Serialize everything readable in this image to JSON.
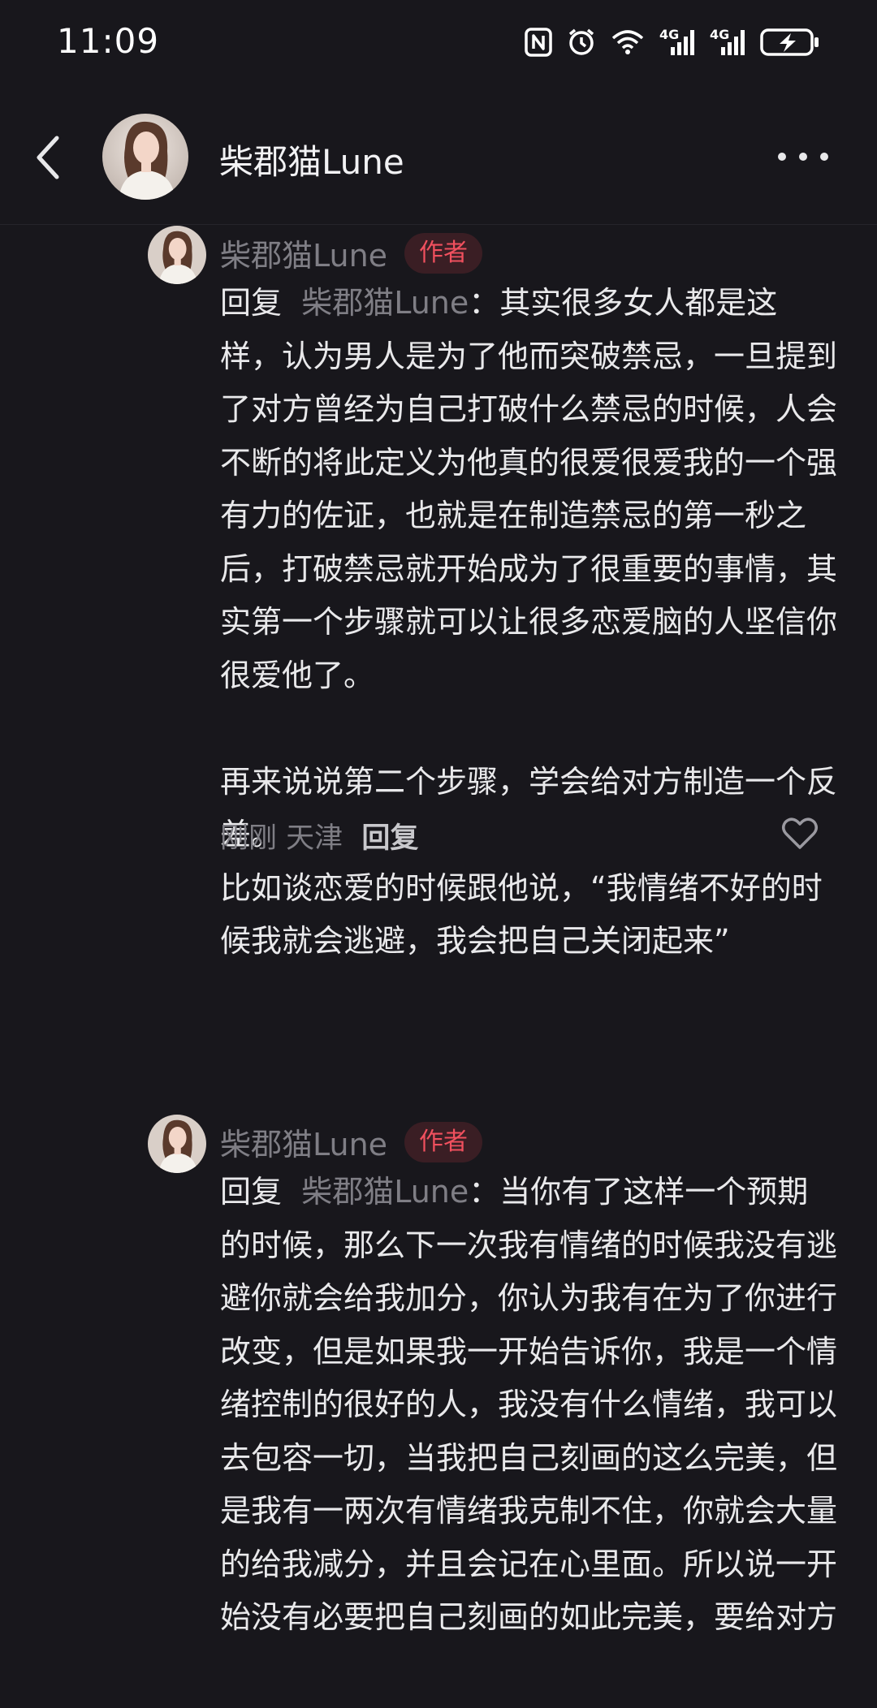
{
  "status_bar": {
    "time": "11:09",
    "icons": [
      "nfc-icon",
      "alarm-icon",
      "wifi-icon",
      "signal-4g-icon",
      "signal-4g-icon",
      "battery-charging-icon"
    ],
    "network_label": "4G"
  },
  "header": {
    "title": "柴郡猫Lune",
    "back_icon": "chevron-left-icon",
    "more_icon": "more-horizontal-icon"
  },
  "comments": [
    {
      "author": "柴郡猫Lune",
      "badge": "作者",
      "reply_label": "回复",
      "reply_target": "柴郡猫Lune",
      "reply_colon": "：",
      "body": "其实很多女人都是这样，认为男人是为了他而突破禁忌，一旦提到了对方曾经为自己打破什么禁忌的时候，人会不断的将此定义为他真的很爱很爱我的一个强有力的佐证，也就是在制造禁忌的第一秒之后，打破禁忌就开始成为了很重要的事情，其实第一个步骤就可以让很多恋爱脑的人坚信你很爱他了。\n\n再来说说第二个步骤，学会给对方制造一个反差。\n比如谈恋爱的时候跟他说，“我情绪不好的时候我就会逃避，我会把自己关闭起来”",
      "time": "刚刚",
      "location": "天津",
      "reply_button": "回复"
    },
    {
      "author": "柴郡猫Lune",
      "badge": "作者",
      "reply_label": "回复",
      "reply_target": "柴郡猫Lune",
      "reply_colon": "：",
      "body": "当你有了这样一个预期的时候，那么下一次我有情绪的时候我没有逃避你就会给我加分，你认为我有在为了你进行改变，但是如果我一开始告诉你，我是一个情绪控制的很好的人，我没有什么情绪，我可以去包容一切，当我把自己刻画的这么完美，但是我有一两次有情绪我克制不住，你就会大量的给我减分，并且会记在心里面。所以说一开始没有必要把自己刻画的如此完美，要给对方"
    }
  ],
  "colors": {
    "background": "#18171c",
    "badge_text": "#f0505e",
    "badge_bg": "#3a1e24",
    "muted_text": "#7f7e85",
    "primary_text": "#e9e9eb"
  }
}
